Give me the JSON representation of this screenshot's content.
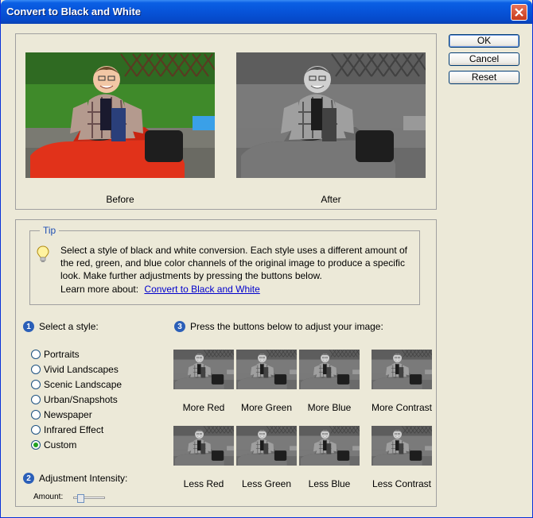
{
  "window": {
    "title": "Convert to Black and White"
  },
  "buttons": {
    "ok": "OK",
    "cancel": "Cancel",
    "reset": "Reset"
  },
  "preview": {
    "before_label": "Before",
    "after_label": "After"
  },
  "tip": {
    "legend": "Tip",
    "text": "Select a style of black and white conversion. Each style uses a different amount of the red, green, and blue color channels of the original image to produce a specific look. Make further adjustments by pressing the buttons below.",
    "learn_label": "Learn more about:",
    "learn_link": "Convert to Black and White"
  },
  "step1": {
    "number": "1",
    "label": "Select a style:",
    "styles": [
      "Portraits",
      "Vivid Landscapes",
      "Scenic Landscape",
      "Urban/Snapshots",
      "Newspaper",
      "Infrared Effect",
      "Custom"
    ],
    "selected": "Custom"
  },
  "step2": {
    "number": "2",
    "label": "Adjustment Intensity:",
    "amount_label": "Amount:",
    "amount_fraction": 0.2
  },
  "step3": {
    "number": "3",
    "label": "Press the buttons below to adjust your image:",
    "more": [
      "More Red",
      "More Green",
      "More Blue",
      "More Contrast"
    ],
    "less": [
      "Less Red",
      "Less Green",
      "Less Blue",
      "Less Contrast"
    ]
  },
  "icons": {
    "close": "close-icon",
    "tip": "lightbulb-icon"
  },
  "colors": {
    "title_bar": "#0753d8",
    "accent": "#1f4fb3",
    "link": "#0000cc",
    "radio_dot": "#21a121"
  }
}
